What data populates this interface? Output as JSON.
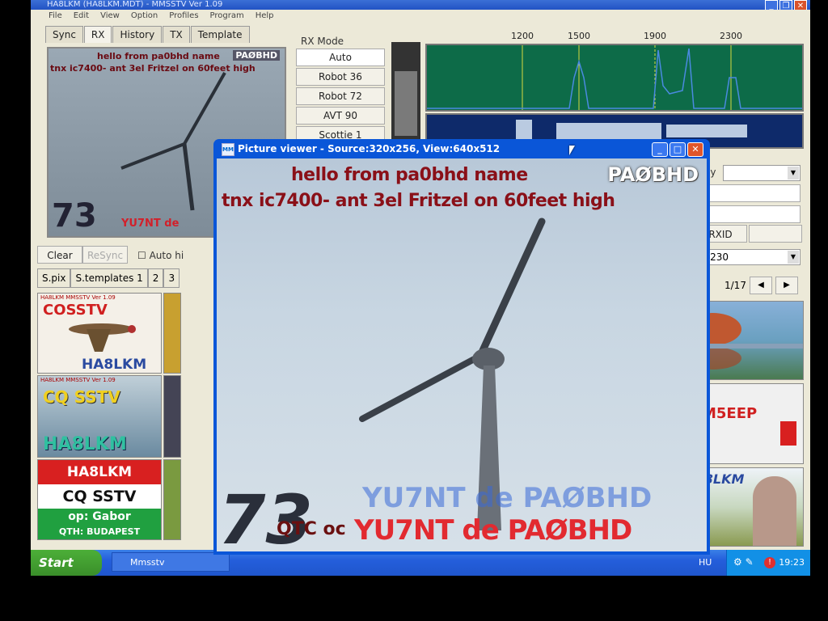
{
  "app": {
    "title": "HA8LKM (HA8LKM.MDT) - MMSSTV Ver 1.09",
    "menu": [
      "File",
      "Edit",
      "View",
      "Option",
      "Profiles",
      "Program",
      "Help"
    ],
    "tabs": [
      "Sync",
      "RX",
      "History",
      "TX",
      "Template"
    ]
  },
  "rx": {
    "mode_label": "RX Mode",
    "modes": [
      "Auto",
      "Robot 36",
      "Robot 72",
      "AVT 90",
      "Scottie 1"
    ],
    "freq_ticks": [
      "1200",
      "1500",
      "1900",
      "2300"
    ],
    "image": {
      "line1": "hello from pa0bhd name",
      "line2": "tnx ic7400- ant 3el Fritzel on 60feet high",
      "tag": "PAØBHD",
      "big": "73",
      "call": "YU7NT de"
    },
    "clear_label": "Clear",
    "resync_label": "ReSync",
    "auto_label": "Auto hi",
    "my_label": "My",
    "rxid_label": "RXID",
    "freq_value": "14.230"
  },
  "thumbs": {
    "tabs": [
      "S.pix",
      "S.templates 1",
      "2",
      "3"
    ],
    "page": "1/17",
    "left": [
      {
        "top": "COSSTV",
        "bottom": "HA8LKM",
        "header": "HA8LKM      MMSSTV Ver 1.09"
      },
      {
        "top": "CQ SSTV",
        "bottom": "HA8LKM",
        "header": "HA8LKM      MMSSTV Ver 1.09"
      },
      {
        "top": "HA8LKM",
        "mid": "CQ SSTV",
        "op": "op: Gabor",
        "qth": "QTH: BUDAPEST"
      }
    ],
    "right": [
      {
        "label": ""
      },
      {
        "label": "SM5EEP"
      },
      {
        "label": "HA8LKM"
      }
    ]
  },
  "viewer": {
    "title": "Picture viewer - Source:320x256, View:640x512",
    "line1": "hello from pa0bhd name",
    "line2": "tnx ic7400- ant 3el Fritzel on 60feet high",
    "tag": "PAØBHD",
    "big": "73",
    "qtc": "QTC oc",
    "call": "YU7NT de PAØBHD"
  },
  "taskbar": {
    "start": "Start",
    "task": "Mmsstv",
    "lang": "HU",
    "clock": "19:23"
  }
}
